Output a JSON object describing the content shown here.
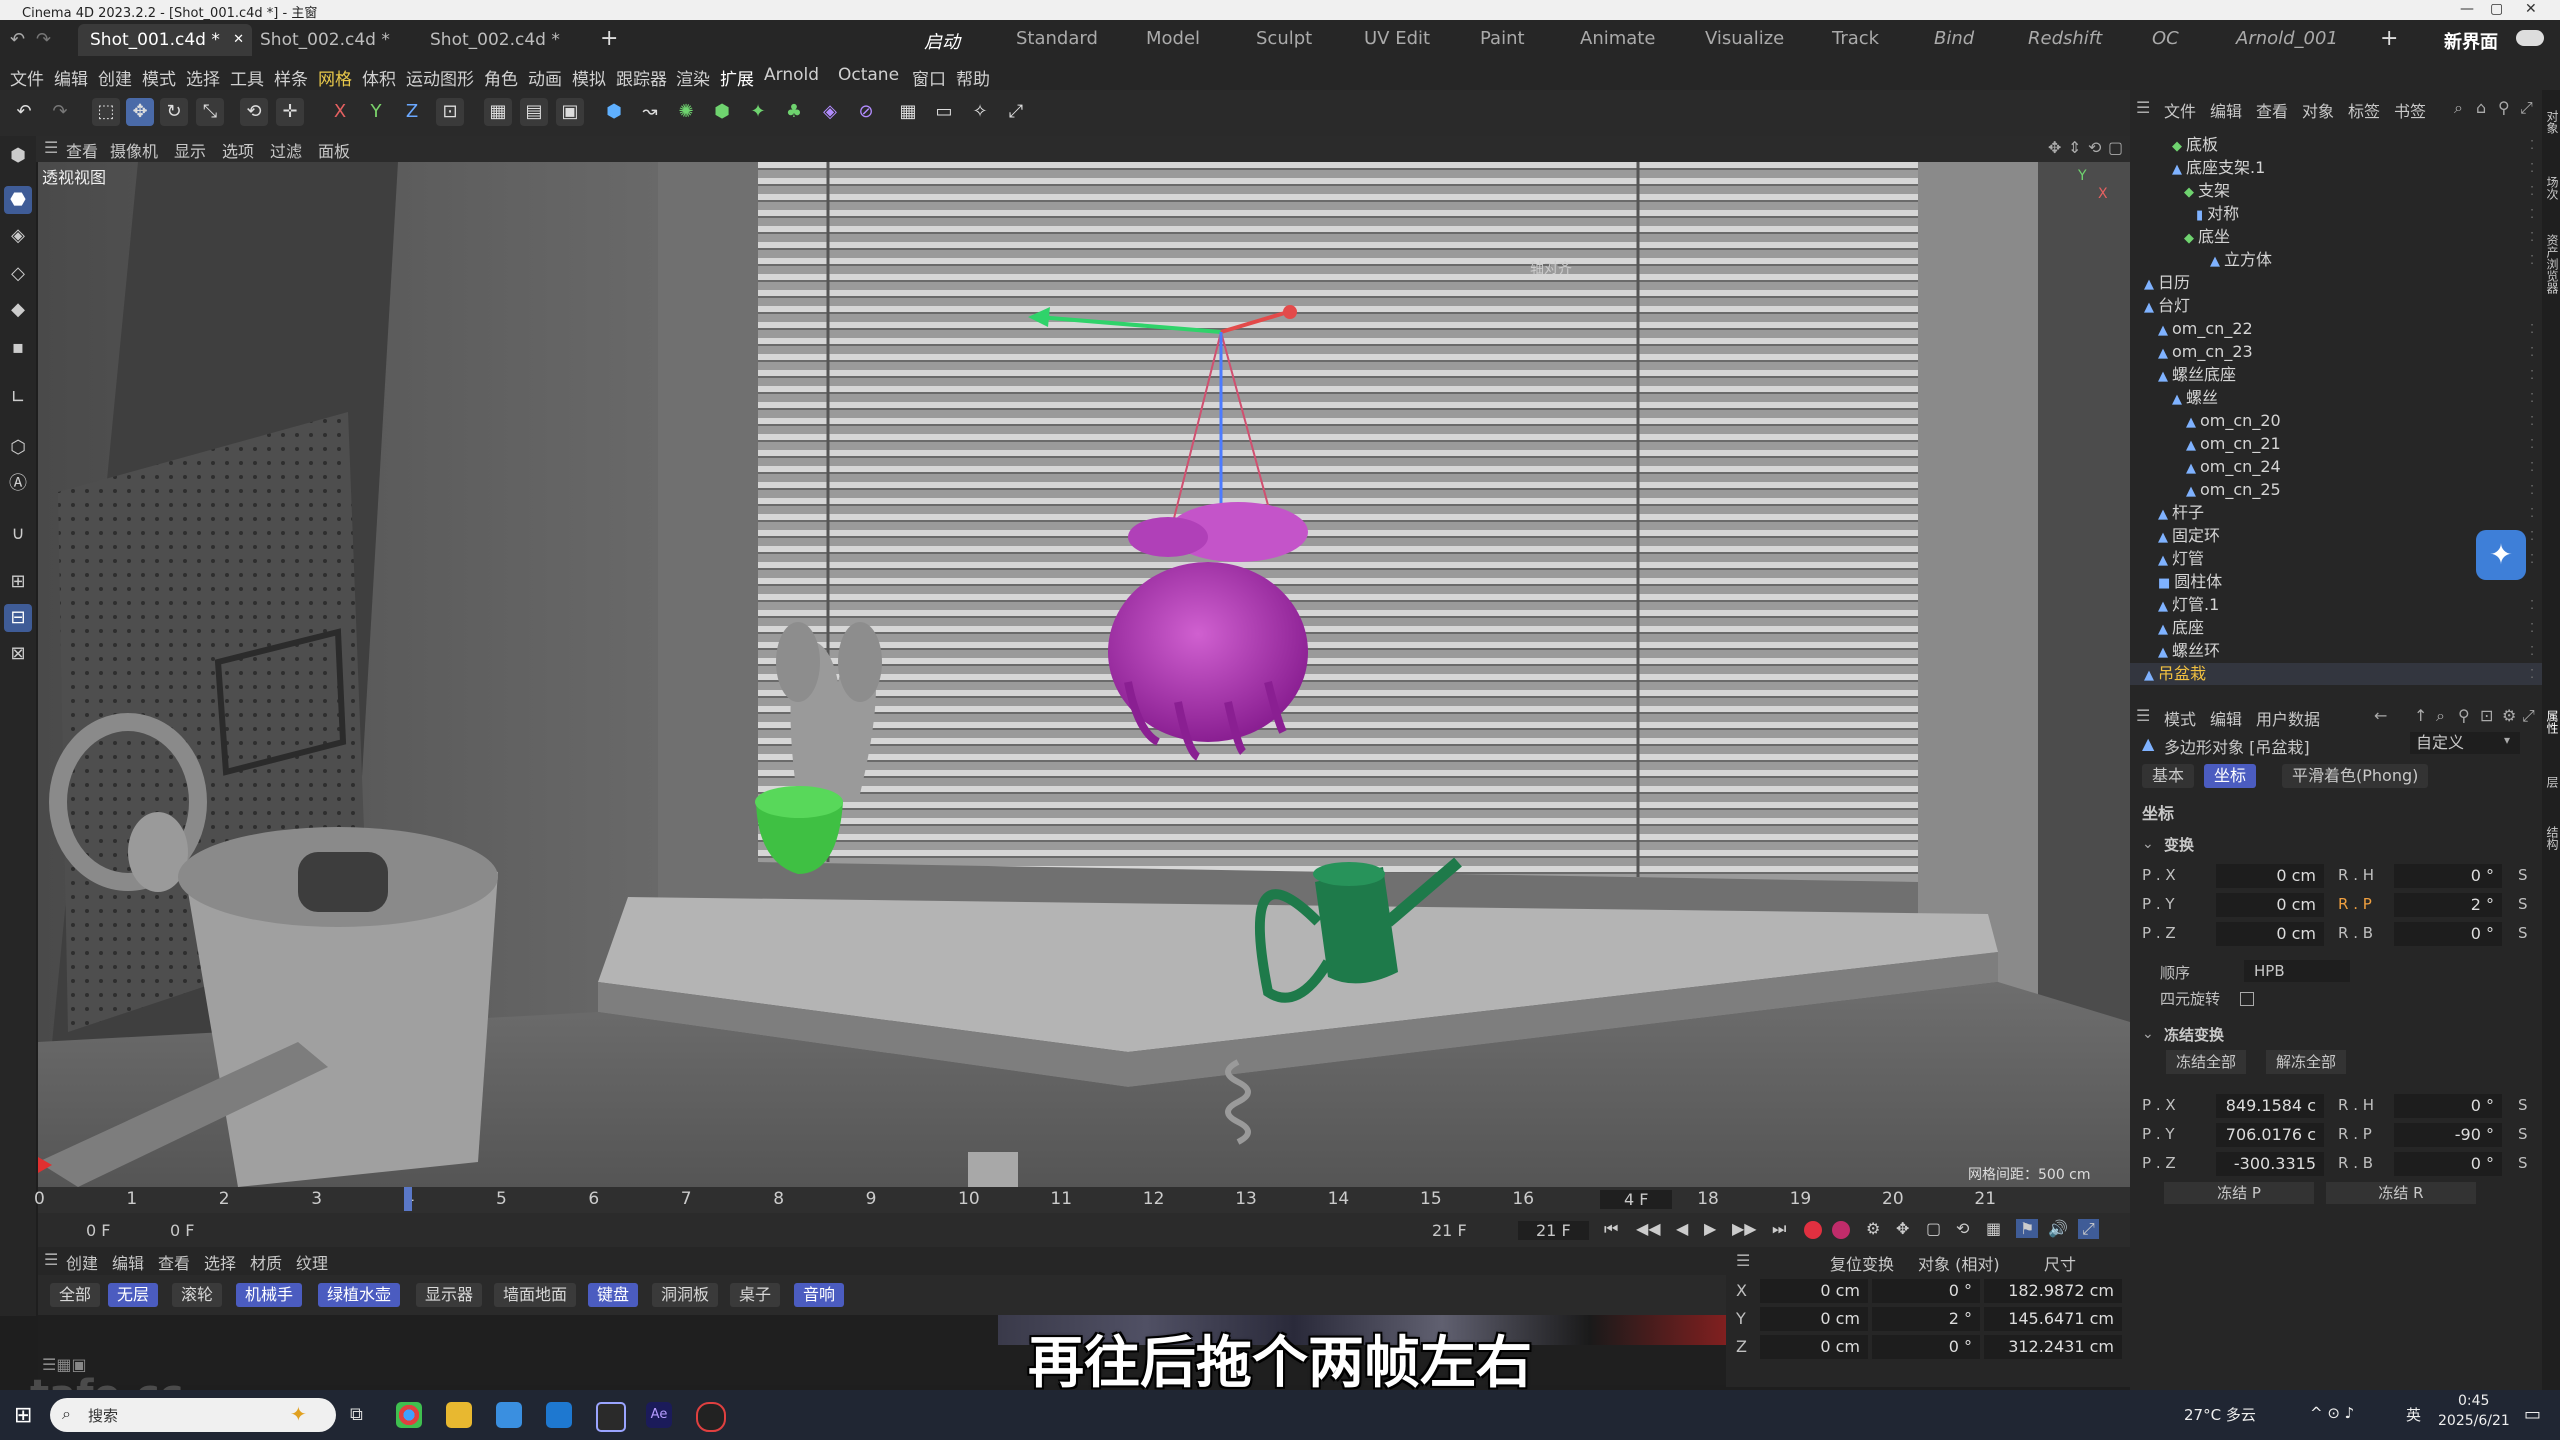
{
  "titlebar": {
    "title": "Cinema 4D 2023.2.2 - [Shot_001.c4d *] - 主窗",
    "min": "—",
    "max": "▢",
    "close": "✕"
  },
  "tabs": [
    {
      "label": "Shot_001.c4d *",
      "active": true
    },
    {
      "label": "Shot_002.c4d *",
      "active": false
    },
    {
      "label": "Shot_002.c4d *",
      "active": false
    }
  ],
  "tab_close": "✕",
  "tab_add": "+",
  "layouts": [
    "启动",
    "Standard",
    "Model",
    "Sculpt",
    "UV Edit",
    "Paint",
    "Animate",
    "Visualize",
    "Track",
    "Bind",
    "Redshift",
    "OC",
    "Arnold_001"
  ],
  "layout_add": "+",
  "new_interface": "新界面",
  "menu": [
    "文件",
    "编辑",
    "创建",
    "模式",
    "选择",
    "工具",
    "样条",
    "网格",
    "体积",
    "运动图形",
    "角色",
    "动画",
    "模拟",
    "跟踪器",
    "渲染",
    "扩展",
    "Arnold",
    "Octane",
    "窗口",
    "帮助"
  ],
  "toolbar": {
    "undo": "↶",
    "redo": "↷",
    "tools": [
      "⬚",
      "✥",
      "↻",
      "⤡",
      "⟲",
      "✛",
      "X",
      "Y",
      "Z",
      "⊡",
      "▦",
      "▤",
      "▣",
      "⬢",
      "↝",
      "✺",
      "⬢",
      "✦",
      "♣",
      "◈",
      "⊘",
      "▦",
      "▭",
      "✧",
      "⤢"
    ]
  },
  "left_tools": [
    "⬢",
    "⬣",
    "◈",
    "◇",
    "◆",
    "▪",
    "∟",
    "⬡",
    "Ⓐ",
    "∪",
    "⊞",
    "⊟",
    "⊠"
  ],
  "viewport": {
    "menu": [
      "查看",
      "摄像机",
      "显示",
      "选项",
      "过滤",
      "面板"
    ],
    "label": "透视视图",
    "axis_label": "轴对齐",
    "grid_info": "网格间距：500 cm",
    "nav_icons": [
      "✥",
      "⇕",
      "⟲",
      "▢"
    ],
    "axis_y": "Y",
    "axis_x": "X"
  },
  "timeline": {
    "ticks": [
      "0",
      "1",
      "2",
      "3",
      "4",
      "5",
      "6",
      "7",
      "8",
      "9",
      "10",
      "11",
      "12",
      "13",
      "14",
      "15",
      "16",
      "17",
      "18",
      "19",
      "20",
      "21"
    ],
    "current_frame": 4,
    "start": "0 F",
    "start2": "0 F",
    "end": "21 F",
    "end2": "21 F",
    "frame_display": "4 F",
    "transport": [
      "⏮",
      "◀◀",
      "◀",
      "▶",
      "▶▶",
      "⏭"
    ]
  },
  "material_manager": {
    "menu": [
      "创建",
      "编辑",
      "查看",
      "选择",
      "材质",
      "纹理"
    ],
    "tags": [
      {
        "label": "全部",
        "on": false
      },
      {
        "label": "无层",
        "on": true
      },
      {
        "label": "滚轮",
        "on": false
      },
      {
        "label": "机械手",
        "on": true
      },
      {
        "label": "绿植水壶",
        "on": true
      },
      {
        "label": "显示器",
        "on": false
      },
      {
        "label": "墙面地面",
        "on": false
      },
      {
        "label": "键盘",
        "on": true
      },
      {
        "label": "洞洞板",
        "on": false
      },
      {
        "label": "桌子",
        "on": false
      },
      {
        "label": "音响",
        "on": true
      }
    ]
  },
  "coords": {
    "header": [
      "复位变换",
      "对象 (相对)",
      "尺寸"
    ],
    "rows": [
      {
        "axis": "X",
        "pos": "0 cm",
        "rot": "0 °",
        "size": "182.9872 cm"
      },
      {
        "axis": "Y",
        "pos": "0 cm",
        "rot": "2 °",
        "size": "145.6471 cm"
      },
      {
        "axis": "Z",
        "pos": "0 cm",
        "rot": "0 °",
        "size": "312.2431 cm"
      }
    ]
  },
  "object_manager": {
    "menu": [
      "文件",
      "编辑",
      "查看",
      "对象",
      "标签",
      "书签"
    ],
    "tree": [
      {
        "label": "底板",
        "indent": 2,
        "icon": "g"
      },
      {
        "label": "底座支架.1",
        "indent": 2,
        "icon": "b"
      },
      {
        "label": "支架",
        "indent": 3,
        "icon": "g"
      },
      {
        "label": "对称",
        "indent": 4,
        "icon": "b"
      },
      {
        "label": "底坐",
        "indent": 3,
        "icon": "g"
      },
      {
        "label": "立方体",
        "indent": 5,
        "icon": "b"
      },
      {
        "label": "日历",
        "indent": 0,
        "icon": "b"
      },
      {
        "label": "台灯",
        "indent": 0,
        "icon": "b"
      },
      {
        "label": "om_cn_22",
        "indent": 1,
        "icon": "b"
      },
      {
        "label": "om_cn_23",
        "indent": 1,
        "icon": "b"
      },
      {
        "label": "螺丝底座",
        "indent": 1,
        "icon": "b"
      },
      {
        "label": "螺丝",
        "indent": 2,
        "icon": "b"
      },
      {
        "label": "om_cn_20",
        "indent": 3,
        "icon": "b"
      },
      {
        "label": "om_cn_21",
        "indent": 3,
        "icon": "b"
      },
      {
        "label": "om_cn_24",
        "indent": 3,
        "icon": "b"
      },
      {
        "label": "om_cn_25",
        "indent": 3,
        "icon": "b"
      },
      {
        "label": "杆子",
        "indent": 1,
        "icon": "b"
      },
      {
        "label": "固定环",
        "indent": 1,
        "icon": "b"
      },
      {
        "label": "灯管",
        "indent": 1,
        "icon": "b"
      },
      {
        "label": "圆柱体",
        "indent": 1,
        "icon": "b"
      },
      {
        "label": "灯管.1",
        "indent": 1,
        "icon": "b"
      },
      {
        "label": "底座",
        "indent": 1,
        "icon": "b"
      },
      {
        "label": "螺丝环",
        "indent": 1,
        "icon": "b"
      },
      {
        "label": "吊盆栽",
        "indent": 0,
        "icon": "b",
        "highlight": true
      }
    ]
  },
  "attributes": {
    "menu": [
      "模式",
      "编辑",
      "用户数据"
    ],
    "object_title": "多边形对象 [吊盆栽]",
    "preset": "自定义",
    "tabs": [
      {
        "label": "基本",
        "active": false
      },
      {
        "label": "坐标",
        "active": true
      },
      {
        "label": "平滑着色(Phong)",
        "active": false
      }
    ],
    "section": "坐标",
    "transform_group": "变换",
    "transform": [
      {
        "plabel": "P . X",
        "pval": "0 cm",
        "rlabel": "R . H",
        "rval": "0 °"
      },
      {
        "plabel": "P . Y",
        "pval": "0 cm",
        "rlabel": "R . P",
        "rval": "2 °"
      },
      {
        "plabel": "P . Z",
        "pval": "0 cm",
        "rlabel": "R . B",
        "rval": "0 °"
      }
    ],
    "order_label": "顺序",
    "order_value": "HPB",
    "quat_label": "四元旋转",
    "freeze_group": "冻结变换",
    "freeze_all": "冻结全部",
    "unfreeze_all": "解冻全部",
    "freeze": [
      {
        "plabel": "P . X",
        "pval": "849.1584 c",
        "rlabel": "R . H",
        "rval": "0 °"
      },
      {
        "plabel": "P . Y",
        "pval": "706.0176 c",
        "rlabel": "R . P",
        "rval": "-90 °"
      },
      {
        "plabel": "P . Z",
        "pval": "-300.3315",
        "rlabel": "R . B",
        "rval": "0 °"
      }
    ],
    "freeze_p": "冻结 P",
    "freeze_r": "冻结 R",
    "s_mark": "S"
  },
  "right_edge": [
    "对象",
    "场次",
    "资产浏览器",
    "属性",
    "层",
    "结构"
  ],
  "subtitle": "再往后拖个两帧左右",
  "taskbar": {
    "search": "搜索",
    "weather": "27°C 多云",
    "lang": "英",
    "time": "0:45",
    "date": "2025/6/21"
  },
  "watermark": "tafe.cc",
  "colors": {
    "accent": "#4b5cc0",
    "plant": "#b040b8",
    "pot": "#3fc043",
    "can": "#1e7a4a"
  }
}
